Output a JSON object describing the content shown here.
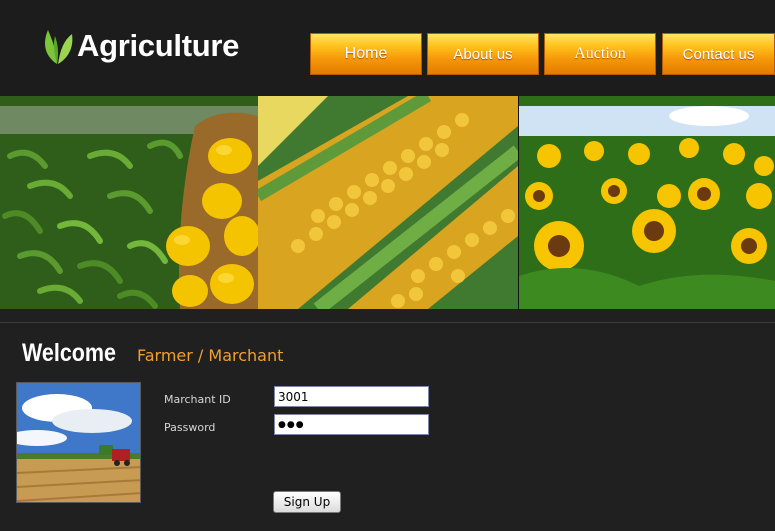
{
  "header": {
    "logo_text": "Agriculture",
    "logo_icon": "leaf-icon",
    "nav": [
      {
        "label": "Home"
      },
      {
        "label": "About us"
      },
      {
        "label": "Auction"
      },
      {
        "label": "Contact us"
      }
    ]
  },
  "banner": {
    "images": [
      "green-beans-and-peppers-photo",
      "corn-cobs-photo",
      "sunflower-field-photo"
    ]
  },
  "welcome": {
    "title": "Welcome",
    "subtitle": "Farmer / Marchant"
  },
  "form": {
    "merchant_label": "Marchant ID",
    "merchant_value": "3001",
    "password_label": "Password",
    "password_mask": "●●●",
    "signup_label": "Sign Up"
  },
  "colors": {
    "background": "#202020",
    "nav_orange": "#f6980a",
    "accent_text": "#f0a030",
    "logo_green": "#7cc43a"
  }
}
